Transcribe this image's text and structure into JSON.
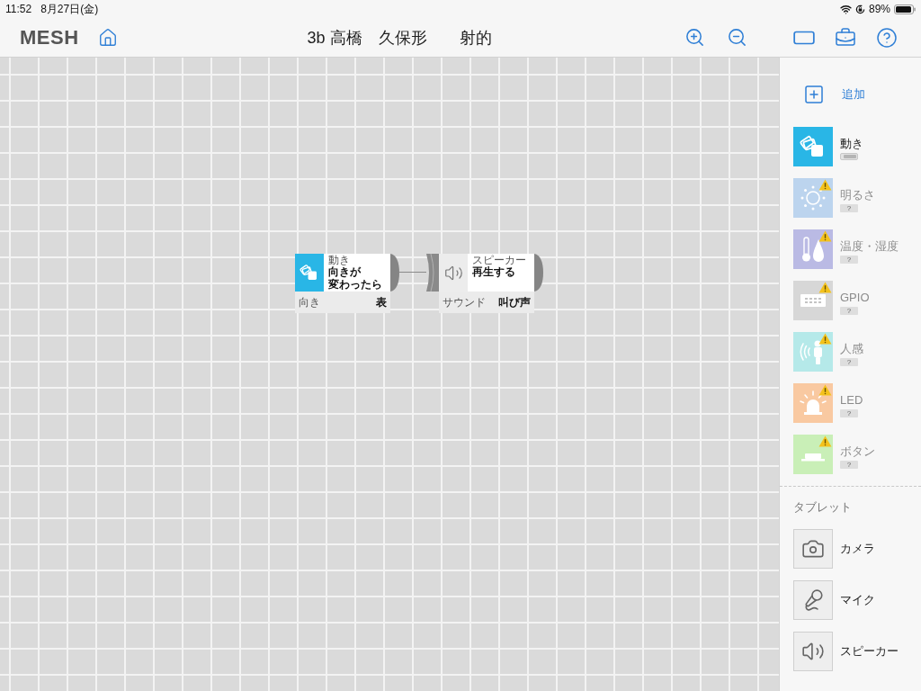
{
  "status_bar": {
    "time": "11:52",
    "date": "8月27日(金)",
    "battery": "89%"
  },
  "header": {
    "logo": "MESH",
    "title": "3b 高橋　久保形　　射的"
  },
  "canvas": {
    "nodes": [
      {
        "kind": "motion",
        "color": "#29b6e6",
        "category": "動き",
        "action_lines": [
          "向きが",
          "変わったら"
        ],
        "param_label": "向き",
        "param_value": "表"
      },
      {
        "kind": "speaker",
        "color": "#ececec",
        "category": "スピーカー",
        "action_lines": [
          "再生する"
        ],
        "param_label": "サウンド",
        "param_value": "叫び声"
      }
    ]
  },
  "sidebar": {
    "add_label": "追加",
    "blocks": [
      {
        "name": "動き",
        "kind": "motion",
        "color": "#29b6e6",
        "connected": true
      },
      {
        "name": "明るさ",
        "kind": "brightness",
        "color": "#bcd4ee",
        "connected": false,
        "badge": "?"
      },
      {
        "name": "温度・湿度",
        "kind": "temperature",
        "color": "#babae4",
        "connected": false,
        "badge": "?"
      },
      {
        "name": "GPIO",
        "kind": "gpio",
        "color": "#d7d7d7",
        "connected": false,
        "badge": "?"
      },
      {
        "name": "人感",
        "kind": "presence",
        "color": "#b5e9e9",
        "connected": false,
        "badge": "?"
      },
      {
        "name": "LED",
        "kind": "led",
        "color": "#f9c9a1",
        "connected": false,
        "badge": "?"
      },
      {
        "name": "ボタン",
        "kind": "button",
        "color": "#c9efb7",
        "connected": false,
        "badge": "?"
      }
    ],
    "tablet_heading": "タブレット",
    "tablet_items": [
      {
        "name": "カメラ",
        "kind": "camera"
      },
      {
        "name": "マイク",
        "kind": "mic"
      },
      {
        "name": "スピーカー",
        "kind": "speaker"
      }
    ]
  }
}
